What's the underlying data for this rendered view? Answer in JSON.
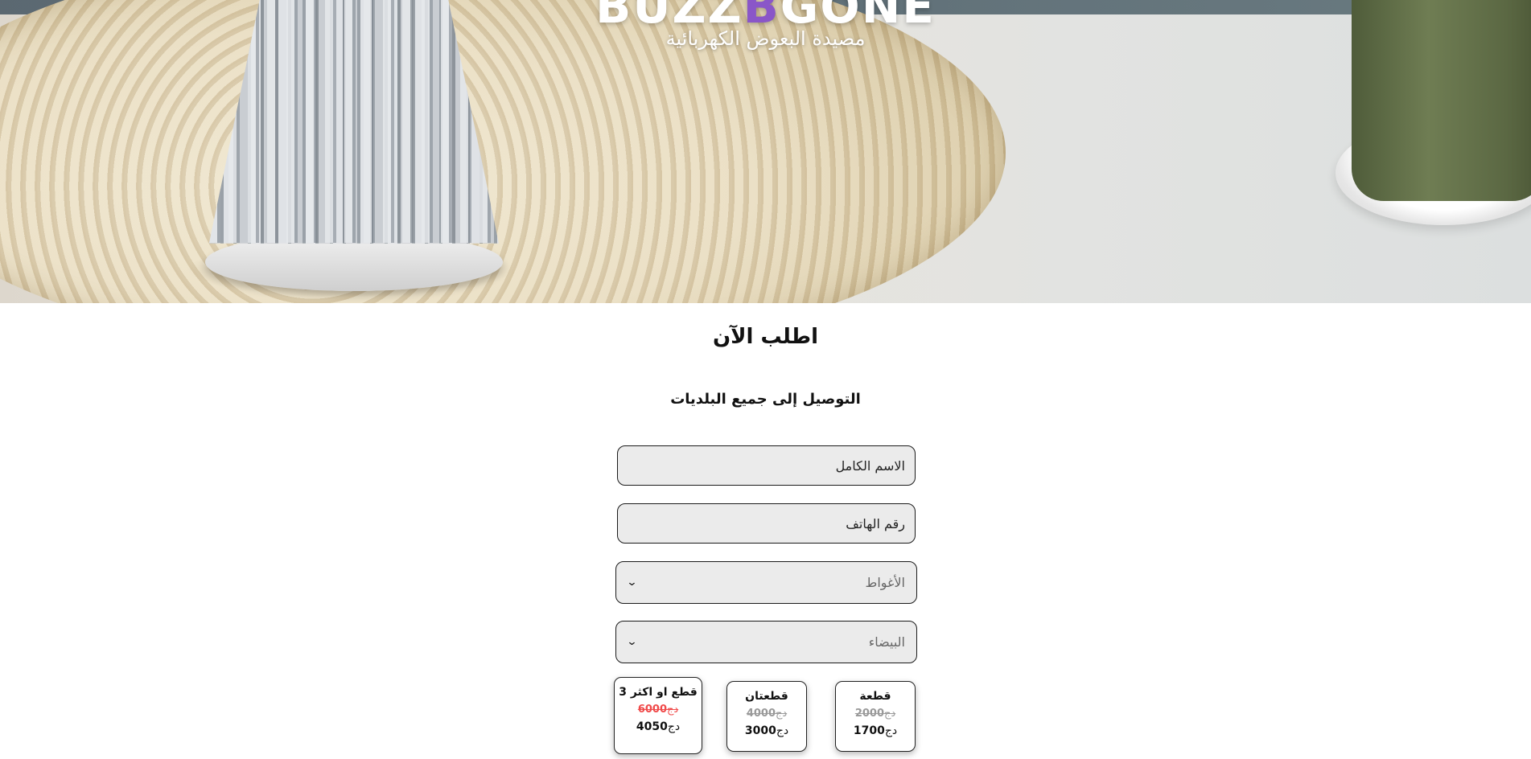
{
  "hero": {
    "brand_prefix": "BUZZ",
    "brand_accent": "B",
    "brand_suffix": "GONE",
    "tagline": "مصيدة البعوض الكهربائية",
    "accent_color": "#8a56c8"
  },
  "order": {
    "title": "اطلب الآن",
    "delivery_note": "التوصيل إلى جميع البلديات"
  },
  "form": {
    "name_placeholder": "الاسم الكامل",
    "phone_placeholder": "رقم الهاتف",
    "wilaya_value": "الأغواط",
    "commune_value": "البيضاء"
  },
  "offers": [
    {
      "title": "قطعة",
      "old_price": "2000",
      "new_price": "1700",
      "currency": "دج"
    },
    {
      "title": "قطعتان",
      "old_price": "4000",
      "new_price": "3000",
      "currency": "دج"
    },
    {
      "title": "3 قطع او اكثر",
      "old_price": "6000",
      "new_price": "4050",
      "currency": "دج"
    }
  ],
  "icons": {
    "select_chevron": "chevron-down-icon"
  }
}
